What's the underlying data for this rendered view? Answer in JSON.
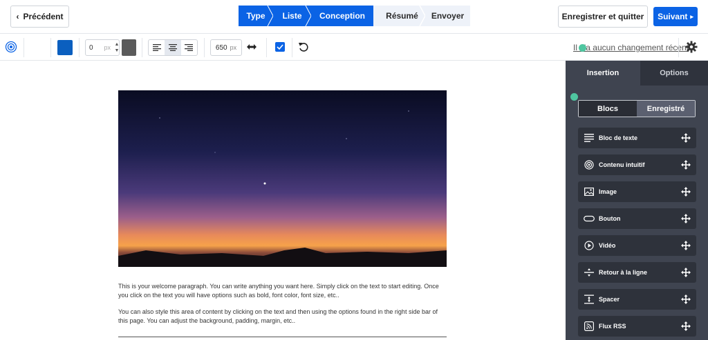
{
  "header": {
    "prev_label": "Précédent",
    "prev_chevron": "‹",
    "save_quit_label": "Enregistrer et quitter",
    "next_label": "Suivant",
    "next_arrow": "▸",
    "steps": [
      {
        "label": "Type",
        "state": "done"
      },
      {
        "label": "Liste",
        "state": "done"
      },
      {
        "label": "Conception",
        "state": "current"
      },
      {
        "label": "Résumé",
        "state": "todo"
      },
      {
        "label": "Envoyer",
        "state": "todo"
      }
    ]
  },
  "toolbar": {
    "border_value": "0",
    "border_unit": "px",
    "width_value": "650",
    "width_unit": "px",
    "color_primary": "#0b5fbf",
    "color_secondary": "#5b5b5b",
    "changes_text": "Il n'a aucun changement récent",
    "checkbox_checked": true
  },
  "canvas": {
    "paragraph1": "This is your welcome paragraph. You can write anything you want here. Simply click on the text to start editing. Once you click on the text you will have options such as bold, font color, font size, etc..",
    "paragraph2": "You can also style this area of content by clicking on the text and then using the options found in the right side bar of this page. You can adjust the background, padding, margin, etc.."
  },
  "sidebar": {
    "tabs": [
      {
        "label": "Insertion",
        "selected": true
      },
      {
        "label": "Options",
        "selected": false
      }
    ],
    "segments": [
      {
        "label": "Blocs",
        "selected": true
      },
      {
        "label": "Enregistré",
        "selected": false
      }
    ],
    "blocks": [
      {
        "label": "Bloc de texte",
        "icon": "text-lines-icon"
      },
      {
        "label": "Contenu intuitif",
        "icon": "target-icon"
      },
      {
        "label": "Image",
        "icon": "image-icon"
      },
      {
        "label": "Bouton",
        "icon": "button-pill-icon"
      },
      {
        "label": "Vidéo",
        "icon": "play-icon"
      },
      {
        "label": "Retour à la ligne",
        "icon": "divider-icon"
      },
      {
        "label": "Spacer",
        "icon": "spacer-icon"
      },
      {
        "label": "Flux RSS",
        "icon": "rss-icon"
      }
    ]
  }
}
